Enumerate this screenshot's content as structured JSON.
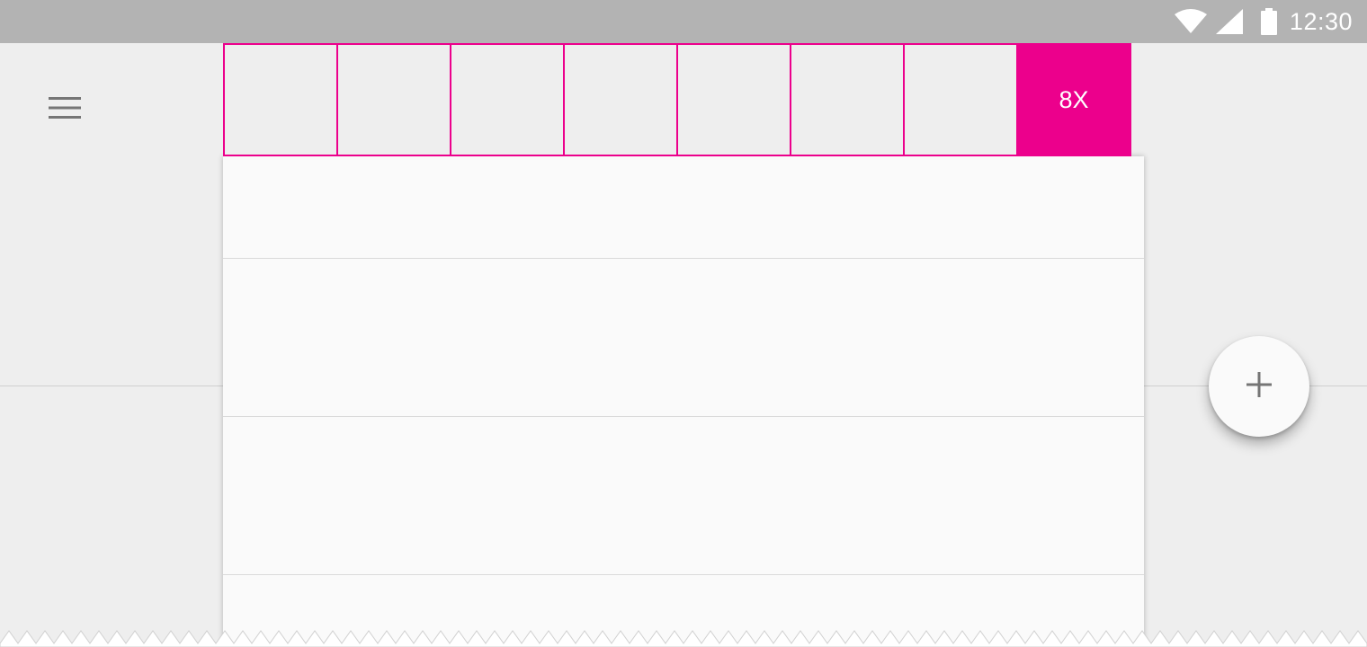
{
  "status_bar": {
    "time": "12:30",
    "icons": [
      "wifi-icon",
      "cell-signal-icon",
      "battery-icon"
    ]
  },
  "toolbar": {
    "menu_icon": "hamburger-menu-icon"
  },
  "keyline_grid": {
    "cells": [
      "",
      "",
      "",
      "",
      "",
      "",
      "",
      "8X"
    ],
    "accent_color": "#ec008c"
  },
  "fab": {
    "icon": "plus-icon"
  },
  "colors": {
    "status_bar": "#b3b3b3",
    "background": "#eeeeee",
    "sheet": "#fafafa",
    "accent": "#ec008c"
  }
}
